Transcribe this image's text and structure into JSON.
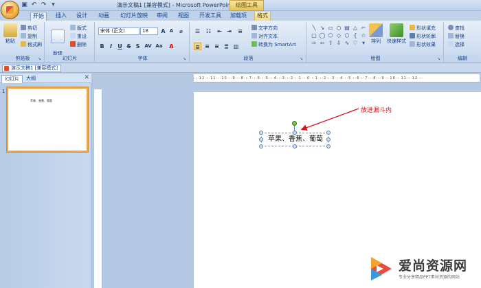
{
  "title_bar": {
    "title": "演示文稿1 [兼容模式] - Microsoft PowerPoint",
    "context_tab_title": "绘图工具"
  },
  "tabs": [
    {
      "label": "开始",
      "active": true
    },
    {
      "label": "插入"
    },
    {
      "label": "设计"
    },
    {
      "label": "动画"
    },
    {
      "label": "幻灯片放映"
    },
    {
      "label": "审阅"
    },
    {
      "label": "视图"
    },
    {
      "label": "开发工具"
    },
    {
      "label": "加载项"
    },
    {
      "label": "格式",
      "contextual": true
    }
  ],
  "ribbon": {
    "clipboard": {
      "label": "剪贴板",
      "paste": "粘贴",
      "cut": "剪切",
      "copy": "复制",
      "format_painter": "格式刷"
    },
    "slides": {
      "label": "幻灯片",
      "new_slide": "新建\n幻灯片",
      "layout": "版式",
      "reset": "重设",
      "delete": "删除"
    },
    "font": {
      "label": "字体",
      "font_name": "宋体 (正文)",
      "font_size": "18"
    },
    "paragraph": {
      "label": "段落",
      "text_direction": "文字方向",
      "align_text": "对齐文本",
      "smartart": "转换为 SmartArt"
    },
    "drawing": {
      "label": "绘图",
      "arrange": "排列",
      "quick_styles": "快速样式",
      "shape_fill": "形状填充",
      "shape_outline": "形状轮廓",
      "shape_effects": "形状效果"
    },
    "editing": {
      "label": "编辑",
      "find": "查找",
      "replace": "替换",
      "select": "选择"
    }
  },
  "document_tab": "演示文稿1 [兼容模式]",
  "left_panel": {
    "tab_slides": "幻灯片",
    "tab_outline": "大纲",
    "slide_number": "1",
    "thumb_text": "苹果、香蕉、葡萄"
  },
  "slide": {
    "textbox_text": "苹果、香蕉、葡萄"
  },
  "annotation": "放进漏斗内",
  "watermark": {
    "title": "爱尚资源网",
    "subtitle": "专业分享精品PPT素材资源的网站"
  },
  "colors": {
    "accent": "#15428b",
    "annotation": "#d2181e",
    "selection_border": "#f3a54b"
  }
}
